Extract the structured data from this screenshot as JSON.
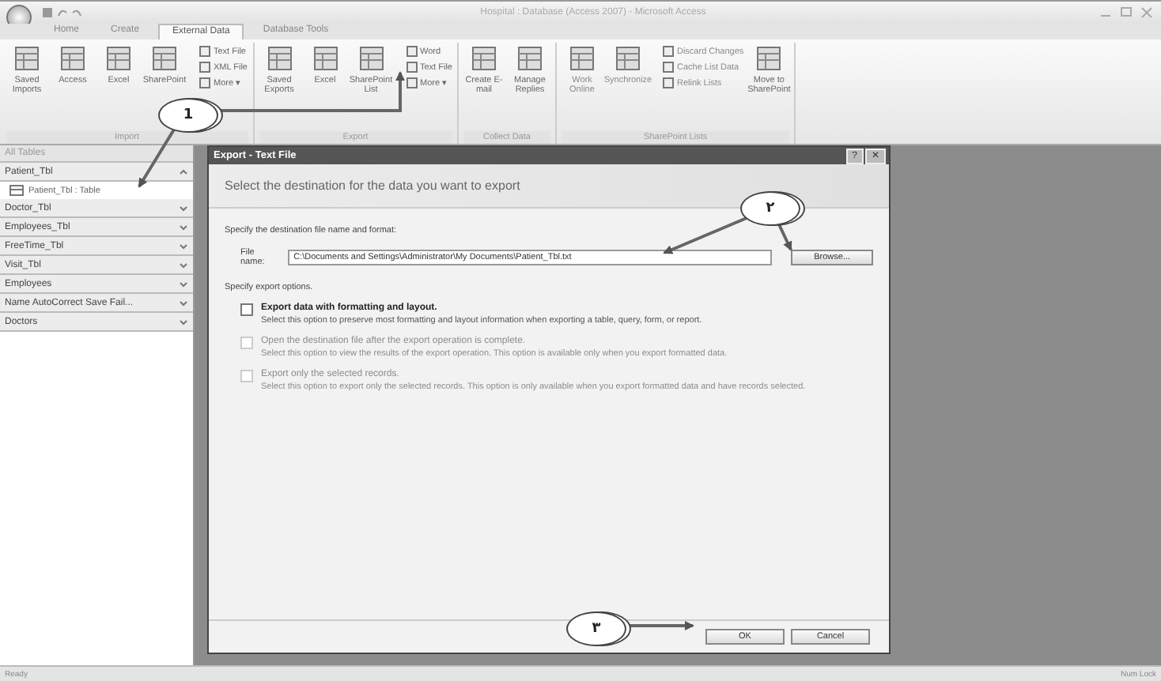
{
  "window": {
    "title": "Hospital : Database (Access 2007) - Microsoft Access"
  },
  "tabs": [
    {
      "label": "Home",
      "selected": false
    },
    {
      "label": "Create",
      "selected": false
    },
    {
      "label": "External Data",
      "selected": true
    },
    {
      "label": "Database Tools",
      "selected": false
    }
  ],
  "ribbon": {
    "groups": [
      {
        "label": "Import",
        "items": [
          {
            "kind": "large",
            "label": "Saved Imports",
            "disabled": false
          },
          {
            "kind": "large",
            "label": "Access",
            "disabled": false
          },
          {
            "kind": "large",
            "label": "Excel",
            "disabled": false
          },
          {
            "kind": "large",
            "label": "SharePoint",
            "disabled": false
          },
          {
            "kind": "stack",
            "items": [
              {
                "label": "Text File",
                "disabled": false
              },
              {
                "label": "XML File",
                "disabled": false
              },
              {
                "label": "More ▾",
                "disabled": false
              }
            ]
          }
        ]
      },
      {
        "label": "Export",
        "items": [
          {
            "kind": "large",
            "label": "Saved Exports",
            "disabled": false
          },
          {
            "kind": "large",
            "label": "Excel",
            "disabled": false
          },
          {
            "kind": "large",
            "label": "SharePoint List",
            "disabled": false
          },
          {
            "kind": "stack",
            "items": [
              {
                "label": "Word",
                "disabled": false
              },
              {
                "label": "Text File",
                "disabled": false
              },
              {
                "label": "More ▾",
                "disabled": false
              }
            ]
          }
        ]
      },
      {
        "label": "Collect Data",
        "items": [
          {
            "kind": "large",
            "label": "Create E-mail",
            "disabled": false
          },
          {
            "kind": "large",
            "label": "Manage Replies",
            "disabled": false
          }
        ]
      },
      {
        "label": "SharePoint Lists",
        "items": [
          {
            "kind": "large",
            "label": "Work Online",
            "disabled": true
          },
          {
            "kind": "large",
            "label": "Synchronize",
            "disabled": true
          },
          {
            "kind": "stack",
            "items": [
              {
                "label": "Discard Changes",
                "disabled": true
              },
              {
                "label": "Cache List Data",
                "disabled": true
              },
              {
                "label": "Relink Lists",
                "disabled": true
              }
            ]
          },
          {
            "kind": "large",
            "label": "Move to SharePoint",
            "disabled": false
          }
        ]
      }
    ]
  },
  "nav": {
    "header": "All Tables",
    "groups": [
      {
        "label": "Patient_Tbl",
        "expanded": true,
        "children": [
          {
            "label": "Patient_Tbl : Table"
          }
        ]
      },
      {
        "label": "Doctor_Tbl",
        "expanded": false
      },
      {
        "label": "Employees_Tbl",
        "expanded": false
      },
      {
        "label": "FreeTime_Tbl",
        "expanded": false
      },
      {
        "label": "Visit_Tbl",
        "expanded": false
      },
      {
        "label": "Employees",
        "expanded": false
      },
      {
        "label": "Name AutoCorrect Save Fail...",
        "expanded": false
      },
      {
        "label": "Doctors",
        "expanded": false
      }
    ]
  },
  "dialog": {
    "title": "Export - Text File",
    "help": "?",
    "close": "✕",
    "heading": "Select the destination for the data you want to export",
    "destination_label": "Specify the destination file name and format:",
    "file_label": "File name:",
    "file_value": "C:\\Documents and Settings\\Administrator\\My Documents\\Patient_Tbl.txt",
    "browse": "Browse...",
    "options_label": "Specify export options.",
    "options": [
      {
        "label": "Export data with formatting and layout.",
        "description": "Select this option to preserve most formatting and layout information when exporting a table, query, form, or report.",
        "checked": false,
        "disabled": false
      },
      {
        "label": "Open the destination file after the export operation is complete.",
        "description": "Select this option to view the results of the export operation. This option is available only when you export formatted data.",
        "checked": false,
        "disabled": true
      },
      {
        "label": "Export only the selected records.",
        "description": "Select this option to export only the selected records. This option is only available when you export formatted data and have records selected.",
        "checked": false,
        "disabled": true
      }
    ],
    "buttons": [
      "OK",
      "Cancel"
    ]
  },
  "callouts": [
    {
      "label": "1"
    },
    {
      "label": "۲"
    },
    {
      "label": "۳"
    }
  ],
  "status_bar": {
    "left": "Ready",
    "right": "Num Lock"
  }
}
